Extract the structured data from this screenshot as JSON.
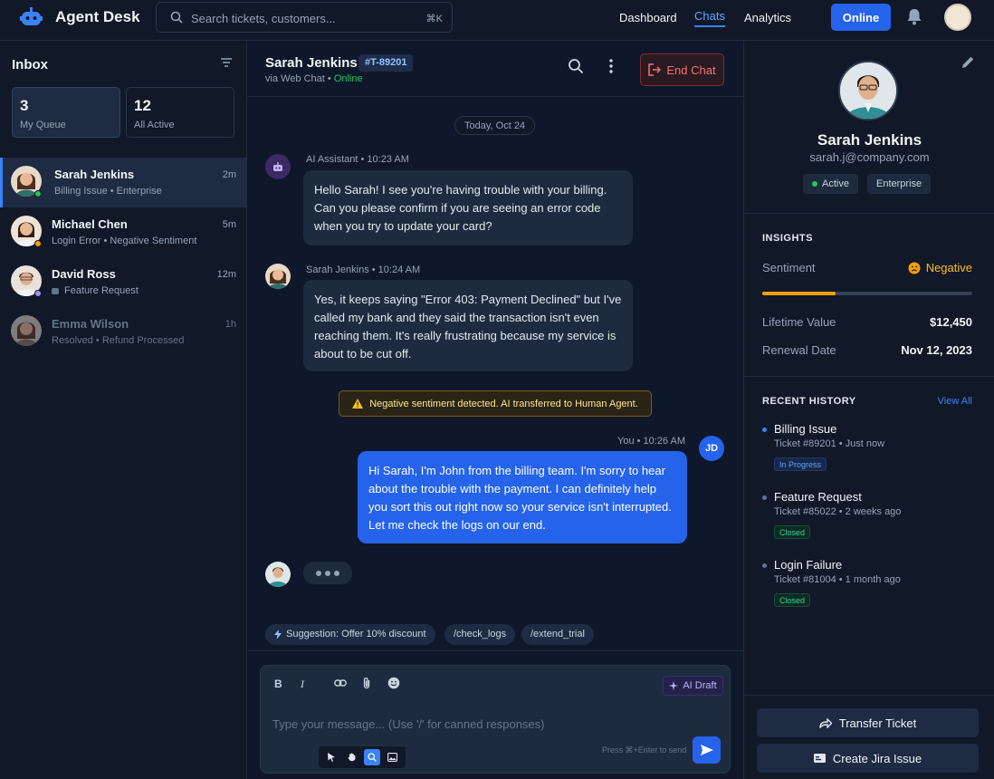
{
  "header": {
    "app_name": "Agent Desk",
    "search_placeholder": "Search tickets, customers...",
    "search_shortcut": "⌘K",
    "nav": [
      "Dashboard",
      "Chats",
      "Analytics"
    ],
    "active_nav": "Chats",
    "status_button": "Online",
    "icons": [
      "robot-logo-icon",
      "search-icon",
      "bell-icon",
      "avatar"
    ]
  },
  "inbox": {
    "title": "Inbox",
    "cards": [
      {
        "count": "3",
        "label": "My Queue"
      },
      {
        "count": "12",
        "label": "All Active"
      }
    ],
    "conversations": [
      {
        "name": "Sarah Jenkins",
        "subtitle": "Billing Issue • Enterprise",
        "time": "2m",
        "status_color": "#22c55e"
      },
      {
        "name": "Michael Chen",
        "subtitle": "Login Error • Negative Sentiment",
        "time": "5m",
        "status_color": "#f59e0b"
      },
      {
        "name": "David Ross",
        "subtitle": "Feature Request",
        "time": "12m",
        "status_color": "#a78bfa"
      },
      {
        "name": "Emma Wilson",
        "subtitle": "Resolved • Refund Processed",
        "time": "1h",
        "status_color": ""
      }
    ]
  },
  "chat": {
    "customer_name": "Sarah Jenkins",
    "ticket_id": "#T-89201",
    "via": "via Web Chat •",
    "online": "Online",
    "end_chat": "End Chat",
    "date": "Today, Oct 24",
    "messages": [
      {
        "meta": "AI Assistant • 10:23 AM",
        "text": "Hello Sarah! I see you're having trouble with your billing. Can you please confirm if you are seeing an error code when you try to update your card?"
      },
      {
        "meta": "Sarah Jenkins • 10:24 AM",
        "text": "Yes, it keeps saying \"Error 403: Payment Declined\" but I've called my bank and they said the transaction isn't even reaching them. It's really frustrating because my service is about to be cut off."
      },
      {
        "meta": "You • 10:26 AM",
        "text": "Hi Sarah, I'm John from the billing team. I'm sorry to hear about the trouble with the payment. I can definitely help you sort this out right now so your service isn't interrupted. Let me check the logs on our end."
      }
    ],
    "agent_initials": "JD",
    "alert": "Negative sentiment detected. AI transferred to Human Agent.",
    "suggestions": [
      "Suggestion: Offer 10% discount",
      "/check_logs",
      "/extend_trial"
    ],
    "composer": {
      "placeholder": "Type your message... (Use '/' for canned responses)",
      "bold": "B",
      "italic": "I",
      "ai_draft": "AI Draft",
      "hint": "Press ⌘+Enter to send"
    }
  },
  "profile": {
    "name": "Sarah Jenkins",
    "email": "sarah.j@company.com",
    "tags": [
      "Active",
      "Enterprise"
    ],
    "insights_title": "INSIGHTS",
    "sentiment_label": "Sentiment",
    "sentiment_value": "Negative",
    "sentiment_level": 0.35,
    "lifetime_label": "Lifetime Value",
    "lifetime_value": "$12,450",
    "renewal_label": "Renewal Date",
    "renewal_value": "Nov 12, 2023",
    "history_title": "RECENT HISTORY",
    "view_all": "View All",
    "history": [
      {
        "title": "Billing Issue",
        "sub": "Ticket #89201 • Just now",
        "status": "In Progress"
      },
      {
        "title": "Feature Request",
        "sub": "Ticket #85022 • 2 weeks ago",
        "status": "Closed"
      },
      {
        "title": "Login Failure",
        "sub": "Ticket #81004 • 1 month ago",
        "status": "Closed"
      }
    ],
    "transfer": "Transfer Ticket",
    "jira": "Create Jira Issue"
  },
  "colors": {
    "accent": "#2563eb",
    "warning": "#fbbf24",
    "danger": "#f87171",
    "success": "#22c55e"
  }
}
